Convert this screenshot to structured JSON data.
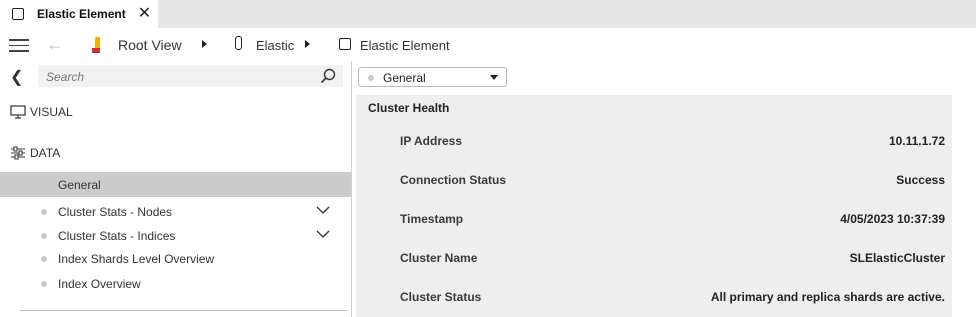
{
  "tab": {
    "title": "Elastic Element"
  },
  "breadcrumb": {
    "root": "Root View",
    "parent": "Elastic",
    "current": "Elastic Element"
  },
  "search": {
    "placeholder": "Search"
  },
  "sidebar": {
    "sections": [
      {
        "label": "VISUAL",
        "icon": "monitor-icon"
      },
      {
        "label": "DATA",
        "icon": "sliders-icon"
      }
    ],
    "items": [
      {
        "label": "General",
        "selected": true,
        "has_dot": false,
        "expandable": false
      },
      {
        "label": "Cluster Stats - Nodes",
        "selected": false,
        "has_dot": true,
        "expandable": true
      },
      {
        "label": "Cluster Stats - Indices",
        "selected": false,
        "has_dot": true,
        "expandable": true
      },
      {
        "label": "Index Shards Level Overview",
        "selected": false,
        "has_dot": true,
        "expandable": false
      },
      {
        "label": "Index Overview",
        "selected": false,
        "has_dot": true,
        "expandable": false
      }
    ]
  },
  "main": {
    "page_selector": {
      "value": "General"
    },
    "card": {
      "title": "Cluster Health",
      "rows": [
        {
          "label": "IP Address",
          "value": "10.11.1.72"
        },
        {
          "label": "Connection Status",
          "value": "Success"
        },
        {
          "label": "Timestamp",
          "value": "4/05/2023 10:37:39"
        },
        {
          "label": "Cluster Name",
          "value": "SLElasticCluster"
        },
        {
          "label": "Cluster Status",
          "value": "All primary and replica shards are active."
        }
      ]
    }
  },
  "colors": {
    "accent_red": "#d42a2a",
    "accent_yellow": "#f0b400",
    "selected_bg": "#cccccc",
    "card_bg": "#eeeeee"
  }
}
